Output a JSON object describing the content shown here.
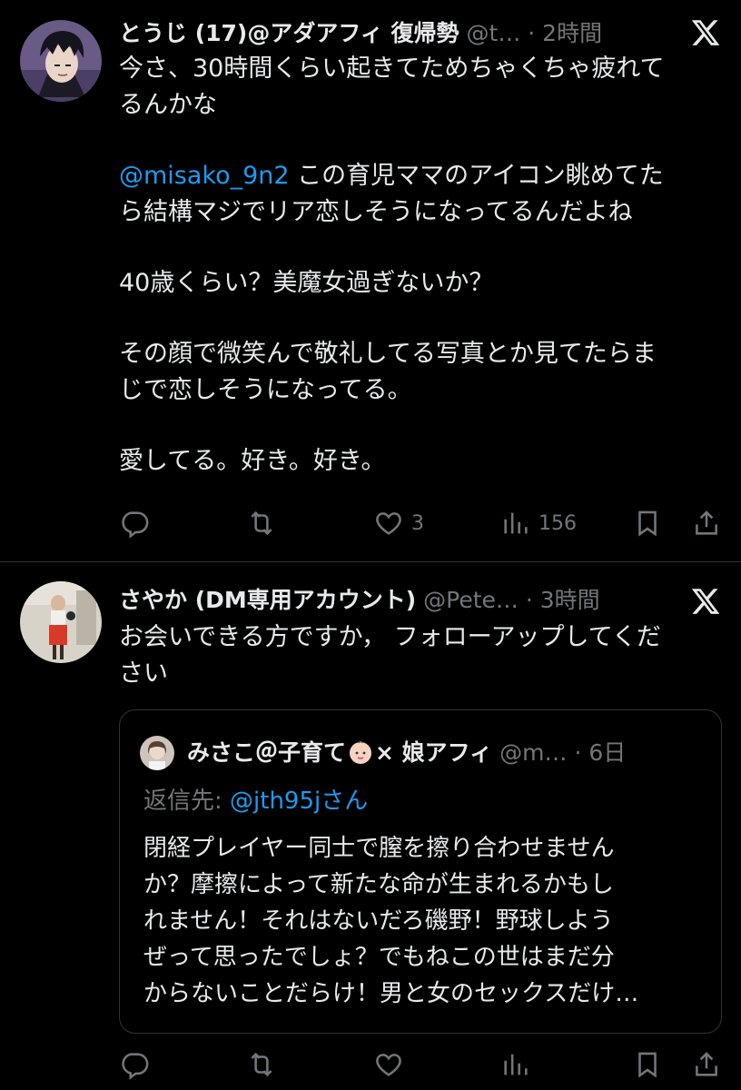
{
  "colors": {
    "background": "#000000",
    "text": "#e7e9ea",
    "secondary": "#71767b",
    "link": "#1d9bf0",
    "border": "#2f3336"
  },
  "tweets": [
    {
      "author_name": "とうじ (17)@アダアフィ 復帰勢",
      "handle": "@t…",
      "time": "· 2時間",
      "body_lines": [
        "今さ、30時間くらい起きてためちゃくちゃ疲れて",
        "るんかな",
        "",
        "@misako_9n2| この育児ママのアイコン眺めてた",
        "ら結構マジでリア恋しそうになってるんだよね",
        "",
        "40歳くらい？美魔女過ぎないか？",
        "",
        "その顔で微笑んで敬礼してる写真とか見てたらま",
        "じで恋しそうになってる。",
        "",
        "愛してる。好き。好き。"
      ],
      "mention": "@misako_9n2",
      "mention_rest": " この育児ママのアイコン眺めてた",
      "likes": "3",
      "views": "156",
      "avatar_icon": "anime-avatar-icon"
    },
    {
      "author_name": "さやか (DM専用アカウント)",
      "handle": "@Pete…",
      "time": "· 3時間",
      "body_lines": [
        "お会いできる方ですか， フォローアップしてくだ",
        "さい"
      ],
      "avatar_icon": "photo-avatar-icon",
      "quote": {
        "author_name_a": "みさこ＠子育て",
        "author_name_b": "× 娘アフィ",
        "handle": "@m…",
        "time": "· 6日",
        "reply_prefix": "返信先: ",
        "reply_to": "@jth95jさん",
        "body_lines": [
          "閉経プレイヤー同士で膣を擦り合わせません",
          "か？摩擦によって新たな命が生まれるかもし",
          "れません！それはないだろ磯野！野球しよう",
          "ぜって思ったでしょ？でもねこの世はまだ分",
          "からないことだらけ！男と女のセックスだけ…"
        ]
      }
    }
  ],
  "icons": [
    "x-logo-icon",
    "reply-icon",
    "retweet-icon",
    "like-icon",
    "views-icon",
    "bookmark-icon",
    "share-icon"
  ]
}
